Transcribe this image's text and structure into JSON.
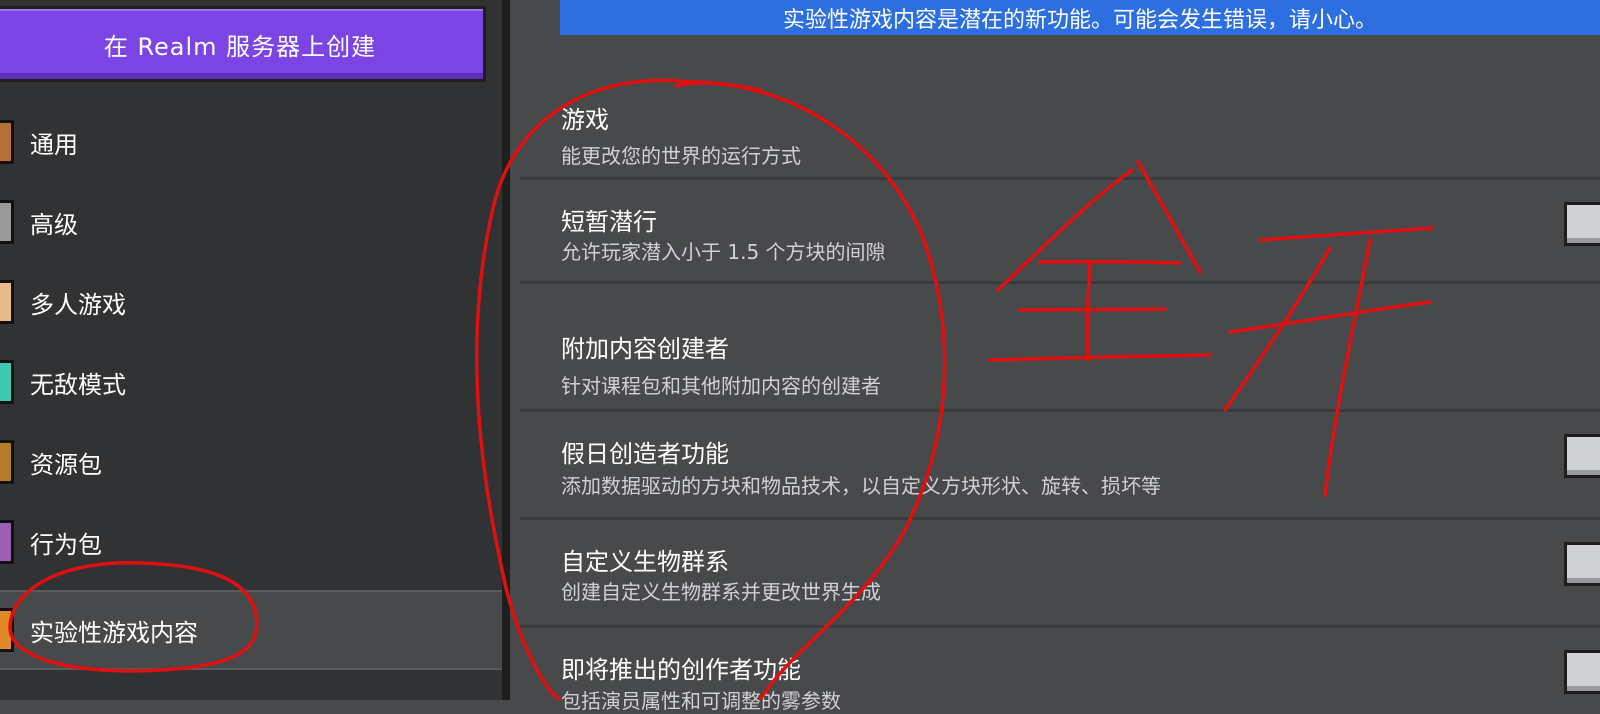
{
  "sidebar": {
    "create_realm_label": "在 Realm 服务器上创建",
    "items": [
      {
        "label": "通用",
        "icon": "gear-icon",
        "color": "#b5703a"
      },
      {
        "label": "高级",
        "icon": "advanced-icon",
        "color": "#9a9a9a"
      },
      {
        "label": "多人游戏",
        "icon": "multiplayer-icon",
        "color": "#e9b98a"
      },
      {
        "label": "无敌模式",
        "icon": "cheats-icon",
        "color": "#3fc7b0"
      },
      {
        "label": "资源包",
        "icon": "resource-pack-icon",
        "color": "#b57a2a"
      },
      {
        "label": "行为包",
        "icon": "behavior-pack-icon",
        "color": "#9b5fb5"
      },
      {
        "label": "实验性游戏内容",
        "icon": "experiments-icon",
        "color": "#e08a2a",
        "selected": true
      }
    ]
  },
  "main": {
    "warning_banner": "实验性游戏内容是潜在的新功能。可能会发生错误，请小心。",
    "sections": [
      {
        "title": "游戏",
        "desc": "能更改您的世界的运行方式"
      },
      {
        "title": "短暂潜行",
        "desc": "允许玩家潜入小于 1.5 个方块的间隙"
      },
      {
        "title": "附加内容创建者",
        "desc": "针对课程包和其他附加内容的创建者"
      },
      {
        "title": "假日创造者功能",
        "desc": "添加数据驱动的方块和物品技术，以自定义方块形状、旋转、损坏等"
      },
      {
        "title": "自定义生物群系",
        "desc": "创建自定义生物群系并更改世界生成"
      },
      {
        "title": "即将推出的创作者功能",
        "desc": "包括演员属性和可调整的雾参数"
      }
    ]
  },
  "annotation": {
    "handwritten_text": "全开",
    "color": "#e01010"
  }
}
